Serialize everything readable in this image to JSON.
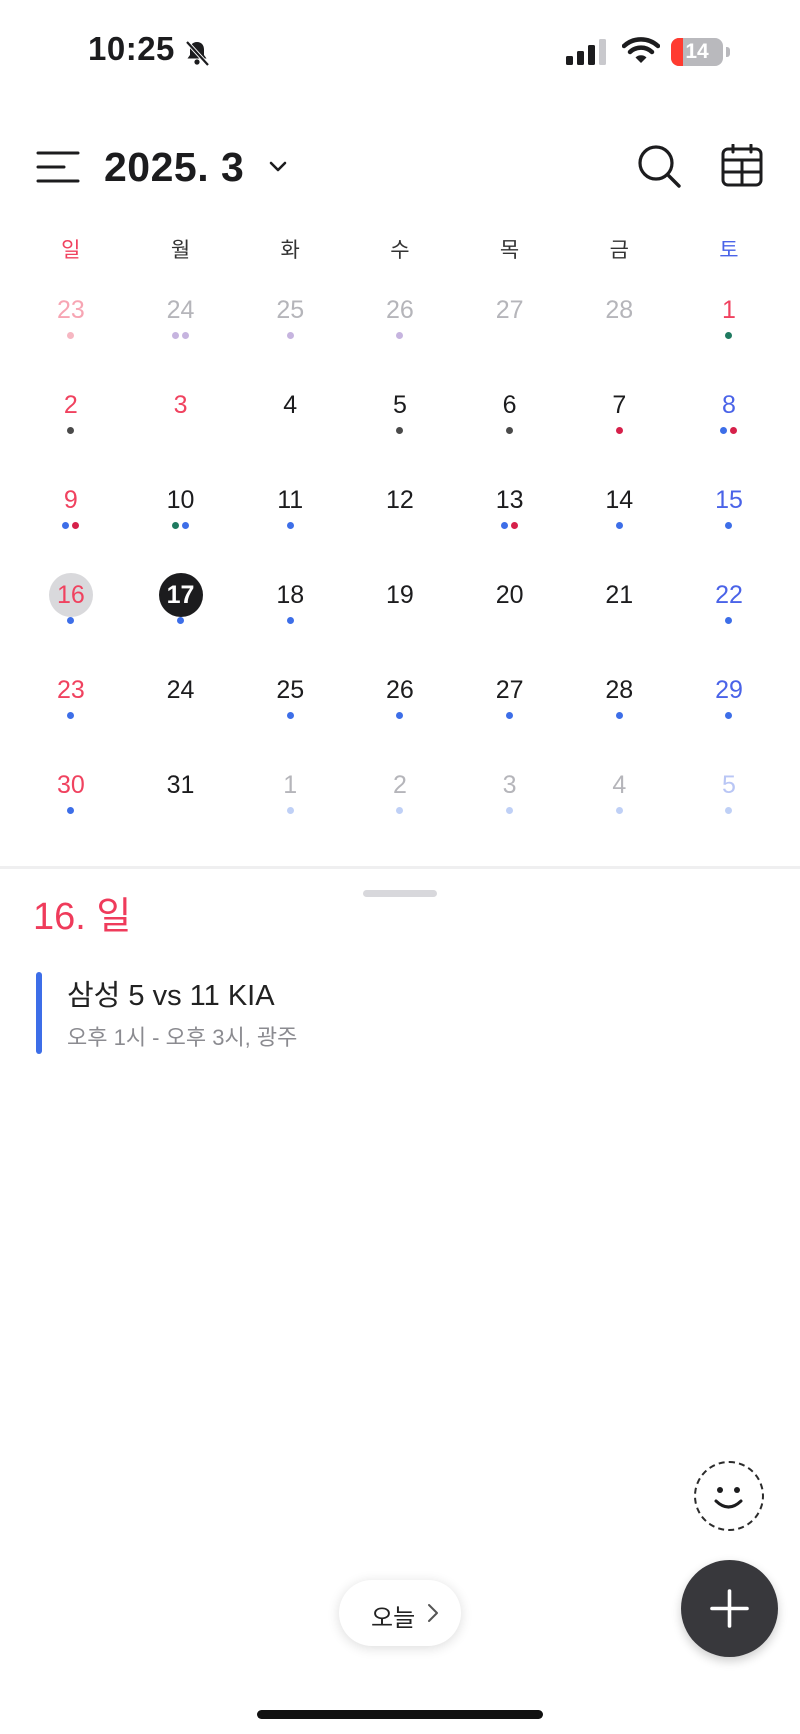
{
  "status_bar": {
    "time": "10:25",
    "battery": "14",
    "battery_level": 0.14
  },
  "header": {
    "title": "2025. 3"
  },
  "weekdays": [
    "일",
    "월",
    "화",
    "수",
    "목",
    "금",
    "토"
  ],
  "colors": {
    "sunday": "#f0425f",
    "saturday": "#4a63e8",
    "weekday": "#1c1c1e",
    "sunday_dim": "#f7a5b3",
    "weekday_dim": "#b5b5ba",
    "saturday_dim": "#b9c6f5",
    "dot_blue": "#3d6ee8",
    "dot_red": "#d6204a",
    "dot_green": "#1f7a60",
    "dot_gray": "#4a4a4a",
    "dot_pink": "#f6b7c2",
    "dot_lavender": "#c6b4df",
    "dot_blue_dim": "#bfd0f6",
    "selected_bg": "#d9d9dc",
    "today_bg": "#1c1c1e"
  },
  "calendar": {
    "weeks": [
      [
        {
          "d": "23",
          "muted": true,
          "dots": [
            "pink"
          ]
        },
        {
          "d": "24",
          "muted": true,
          "dots": [
            "lavender",
            "lavender"
          ]
        },
        {
          "d": "25",
          "muted": true,
          "dots": [
            "lavender"
          ]
        },
        {
          "d": "26",
          "muted": true,
          "dots": [
            "lavender"
          ]
        },
        {
          "d": "27",
          "muted": true,
          "dots": []
        },
        {
          "d": "28",
          "muted": true,
          "dots": []
        },
        {
          "d": "1",
          "holiday": true,
          "dots": [
            "green"
          ]
        }
      ],
      [
        {
          "d": "2",
          "dots": [
            "gray"
          ]
        },
        {
          "d": "3",
          "holiday": true,
          "dots": []
        },
        {
          "d": "4",
          "dots": []
        },
        {
          "d": "5",
          "dots": [
            "gray"
          ]
        },
        {
          "d": "6",
          "dots": [
            "gray"
          ]
        },
        {
          "d": "7",
          "dots": [
            "red"
          ]
        },
        {
          "d": "8",
          "dots": [
            "blue",
            "red"
          ]
        }
      ],
      [
        {
          "d": "9",
          "dots": [
            "blue",
            "red"
          ]
        },
        {
          "d": "10",
          "dots": [
            "green",
            "blue"
          ]
        },
        {
          "d": "11",
          "dots": [
            "blue"
          ]
        },
        {
          "d": "12",
          "dots": []
        },
        {
          "d": "13",
          "dots": [
            "blue",
            "red"
          ]
        },
        {
          "d": "14",
          "dots": [
            "blue"
          ]
        },
        {
          "d": "15",
          "dots": [
            "blue"
          ]
        }
      ],
      [
        {
          "d": "16",
          "selected": true,
          "dots": [
            "blue"
          ]
        },
        {
          "d": "17",
          "today": true,
          "dots": [
            "blue"
          ]
        },
        {
          "d": "18",
          "dots": [
            "blue"
          ]
        },
        {
          "d": "19",
          "dots": []
        },
        {
          "d": "20",
          "dots": []
        },
        {
          "d": "21",
          "dots": []
        },
        {
          "d": "22",
          "dots": [
            "blue"
          ]
        }
      ],
      [
        {
          "d": "23",
          "dots": [
            "blue"
          ]
        },
        {
          "d": "24",
          "dots": []
        },
        {
          "d": "25",
          "dots": [
            "blue"
          ]
        },
        {
          "d": "26",
          "dots": [
            "blue"
          ]
        },
        {
          "d": "27",
          "dots": [
            "blue"
          ]
        },
        {
          "d": "28",
          "dots": [
            "blue"
          ]
        },
        {
          "d": "29",
          "dots": [
            "blue"
          ]
        }
      ],
      [
        {
          "d": "30",
          "dots": [
            "blue"
          ]
        },
        {
          "d": "31",
          "dots": []
        },
        {
          "d": "1",
          "muted": true,
          "dots": [
            "blue_dim"
          ]
        },
        {
          "d": "2",
          "muted": true,
          "dots": [
            "blue_dim"
          ]
        },
        {
          "d": "3",
          "muted": true,
          "dots": [
            "blue_dim"
          ]
        },
        {
          "d": "4",
          "muted": true,
          "dots": [
            "blue_dim"
          ]
        },
        {
          "d": "5",
          "muted": true,
          "dots": [
            "blue_dim"
          ]
        }
      ]
    ]
  },
  "selected_day": {
    "label": "16. 일"
  },
  "events": [
    {
      "title": "삼성 5 vs 11 KIA",
      "detail": "오후 1시 - 오후 3시, 광주"
    }
  ],
  "today_button": {
    "label": "오늘"
  },
  "icons": [
    "bell-slash-icon",
    "signal-icon",
    "wifi-icon",
    "battery-icon",
    "menu-icon",
    "chevron-down-icon",
    "search-icon",
    "calendar-grid-icon",
    "smiley-icon",
    "plus-icon",
    "chevron-right-icon"
  ]
}
